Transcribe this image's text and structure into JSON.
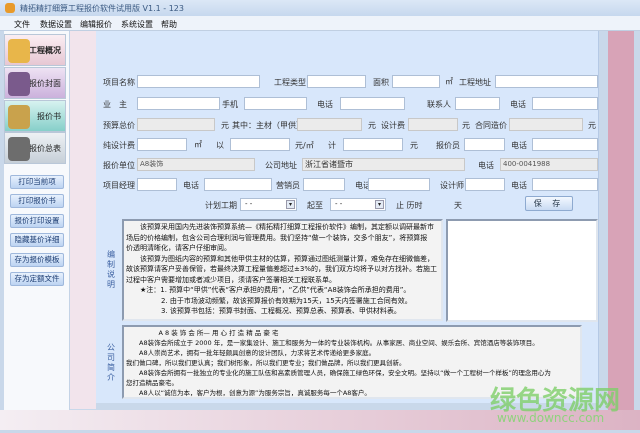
{
  "window": {
    "title": "精拓精打细算工程报价软件试用版 V1.1   -   123"
  },
  "menu": [
    "文件",
    "数据设置",
    "编辑报价",
    "系统设置",
    "帮助"
  ],
  "sidebar": {
    "tabs": [
      "工程概况",
      "报价封面",
      "报价书",
      "报价总表"
    ],
    "buttons": [
      "打印当前项",
      "打印报价书",
      "报价打印设置",
      "隐藏基价详细",
      "存为报价模板",
      "存为定额文件"
    ]
  },
  "form": {
    "project_name": "项目名称",
    "project_type": "工程类型",
    "area": "面积",
    "sqm": "㎡",
    "project_address": "工程地址",
    "owner": "业　主",
    "mobile": "手机",
    "phone": "电话",
    "contact": "联系人",
    "budget_total": "预算总价",
    "yuan": "元",
    "main_material": "其中：主材（甲供）",
    "design_fee": "设计费",
    "contract_price": "合同造价",
    "pure_design_fee": "纯设计费",
    "by": "以",
    "yuan_per_sqm": "元/㎡",
    "total": "计",
    "quoter": "报价员",
    "quote_unit": "报价单位",
    "quote_unit_value": "A8装饰",
    "company_address": "公司地址",
    "company_address_value": "浙江省诸暨市",
    "company_phone_value": "400-0041988",
    "pm": "项目经理",
    "sales": "营销员",
    "designer": "设计师",
    "plan_period": "计划工期",
    "date_placeholder": "-  -",
    "from_to": "起至",
    "until_duration": "止 历时",
    "days": "天",
    "save": "保 存"
  },
  "notes": {
    "label": "编制说明",
    "lines": [
      "　　该预算采用国内先进装饰预算系统—《精拓精打细算工程报价软件》编制，其定额以调研最新市",
      "场后的价格编制，包含公司合理利润与管理费用。我们坚持“做一个装饰，交多个朋友”，将预算报",
      "价透明清晰化，请客户仔细审阅。",
      "　　该预算为图纸内容的预算和其他甲供主材的估算，预算通过图纸测量计算，难免存在细微偏差，",
      "故该预算请客户妥善保管，若最终决算工程量偏差超过±3%的，我们双方均将予以对方找补。若施工",
      "过程中客户需要增加或者减少项目，须请客户签署相关工程联系单。",
      "　　★注：1. 预算中“甲供”代表“客户承担的费用”，“乙供”代表“A8装饰会所承担的费用”。",
      "　　　　　2. 由于市场波动频繁，故该预算报价有效期为15天，15天内签署施工合同有效。",
      "　　　　　3. 该预算书包括：预算书封面、工程概况、预算总表、预算表、甲供材料表。"
    ]
  },
  "company": {
    "label": "公司简介",
    "lines": [
      "　　　　　A 8 装 饰 会 所— 用 心 打 造 精 品 豪 宅",
      "　　A8装饰会所成立于 2000 年，是一家集设计、施工和服务为一体的专业装饰机构。从事家居、商业空间、娱乐会所、宾馆酒店等装饰项目。",
      "　　A8人崇尚艺术，拥有一批年轻颇具创意的设计团队，力求将艺术传递给更多家庭。",
      "我们做口碑，所以我们更认真；我们树形象，所以我们更专业；我们做品牌，所以我们更具创新。",
      "　　A8装饰会所拥有一批独立的专业化的施工队伍和高素质管理人员，确保施工绿色环保，安全文明。坚持以“做一个工程树一个样板”的理念用心为",
      "您打造精品豪宅。",
      "　　A8人以“诚信为本，客户为根，创意为源”为服务宗旨，真诚服务每一个A8客户。"
    ]
  },
  "watermark": {
    "cn": "绿色资源网",
    "url": "www.downcc.com"
  }
}
